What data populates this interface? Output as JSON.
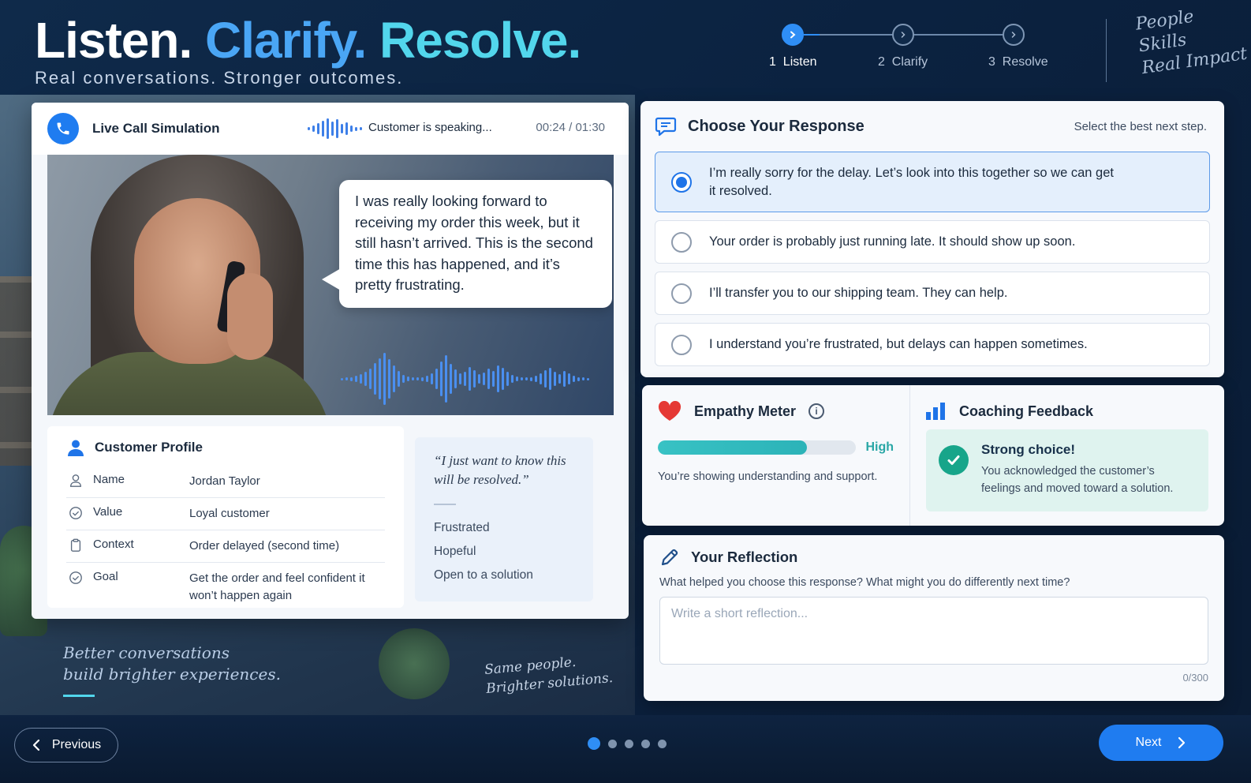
{
  "hero": {
    "title_word1": "Listen.",
    "title_word2": "Clarify.",
    "title_word3": "Resolve.",
    "subtitle": "Real conversations. Stronger outcomes."
  },
  "stepper": {
    "steps": [
      {
        "num": "1",
        "label": "Listen",
        "active": true
      },
      {
        "num": "2",
        "label": "Clarify",
        "active": false
      },
      {
        "num": "3",
        "label": "Resolve",
        "active": false
      }
    ]
  },
  "brand": {
    "line1": "People",
    "line2": "Skills",
    "line3": "Real Impact"
  },
  "call": {
    "title": "Live Call Simulation",
    "status": "Customer is speaking...",
    "timer": "00:24 / 01:30",
    "message": "I was really looking forward to receiving my order this week, but it still hasn’t arrived. This is the second time this has happened, and it’s pretty frustrating."
  },
  "profile": {
    "title": "Customer Profile",
    "rows": [
      {
        "icon": "person-icon",
        "key": "Name",
        "value": "Jordan Taylor"
      },
      {
        "icon": "heart-check-icon",
        "key": "Value",
        "value": "Loyal customer"
      },
      {
        "icon": "clipboard-icon",
        "key": "Context",
        "value": "Order delayed (second time)"
      },
      {
        "icon": "target-check-icon",
        "key": "Goal",
        "value": "Get the order and feel confident it won’t happen again"
      }
    ]
  },
  "feelings": {
    "quote": "“I just want to know this will be resolved.”",
    "items": [
      "Frustrated",
      "Hopeful",
      "Open to a solution"
    ]
  },
  "response": {
    "title": "Choose Your Response",
    "hint": "Select the best next step.",
    "options": [
      {
        "text": "I’m really sorry for the delay. Let’s look into this together so we can get it resolved.",
        "selected": true
      },
      {
        "text": "Your order is probably just running late. It should show up soon.",
        "selected": false
      },
      {
        "text": "I’ll transfer you to our shipping team. They can help.",
        "selected": false
      },
      {
        "text": "I understand you’re frustrated, but delays can happen sometimes.",
        "selected": false
      }
    ]
  },
  "empathy": {
    "title": "Empathy Meter",
    "level_label": "High",
    "level_fraction": 0.75,
    "text": "You’re showing understanding and support."
  },
  "coaching": {
    "title": "Coaching Feedback",
    "heading": "Strong choice!",
    "body": "You acknowledged the customer’s feelings and moved toward a solution."
  },
  "reflection": {
    "title": "Your Reflection",
    "question": "What helped you choose this response? What might you do differently next time?",
    "placeholder": "Write a short reflection...",
    "value": "",
    "counter": "0/300"
  },
  "scene": {
    "quote1_line1": "Better conversations",
    "quote1_line2": "build brighter experiences.",
    "quote2_line1": "Same people.",
    "quote2_line2": "Brighter solutions."
  },
  "footer": {
    "prev_label": "Previous",
    "next_label": "Next",
    "pagination_total": 5,
    "pagination_active": 1
  },
  "colors": {
    "accent_blue": "#1f7cf0",
    "accent_cyan": "#52d6ec",
    "teal": "#2cb3b8",
    "success": "#17a58a",
    "background": "#0b2240"
  }
}
